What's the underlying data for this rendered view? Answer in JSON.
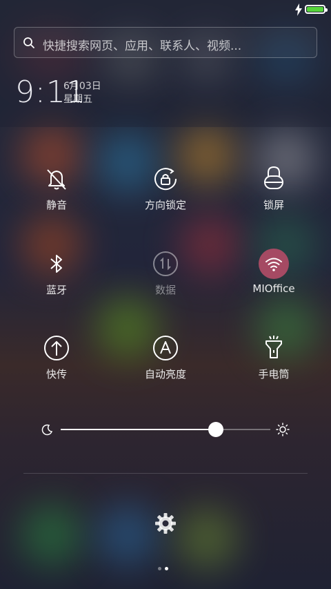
{
  "statusbar": {
    "charging_icon": "lightning-bolt-icon",
    "battery_level": 1.0,
    "battery_color": "#56d43b"
  },
  "search": {
    "placeholder": "快捷搜索网页、应用、联系人、视频...",
    "icon": "search-icon"
  },
  "clock": {
    "time": "9:11",
    "date": "6月03日",
    "weekday": "星期五"
  },
  "toggles": [
    {
      "label": "静音",
      "icon": "bell-off-icon",
      "state": "off"
    },
    {
      "label": "方向锁定",
      "icon": "rotation-lock-icon",
      "state": "off"
    },
    {
      "label": "锁屏",
      "icon": "lock-icon",
      "state": "off"
    },
    {
      "label": "蓝牙",
      "icon": "bluetooth-icon",
      "state": "off"
    },
    {
      "label": "数据",
      "icon": "data-transfer-icon",
      "state": "disabled"
    },
    {
      "label": "MIOffice",
      "icon": "wifi-icon",
      "state": "on",
      "active_color": "#a54a63"
    },
    {
      "label": "快传",
      "icon": "upload-icon",
      "state": "off"
    },
    {
      "label": "自动亮度",
      "icon": "auto-brightness-icon",
      "state": "off"
    },
    {
      "label": "手电筒",
      "icon": "flashlight-icon",
      "state": "off"
    }
  ],
  "brightness": {
    "level": 0.74,
    "min_icon": "moon-icon",
    "max_icon": "sun-icon"
  },
  "footer": {
    "settings_icon": "gear-icon",
    "page_count": 2,
    "current_page": 2
  }
}
